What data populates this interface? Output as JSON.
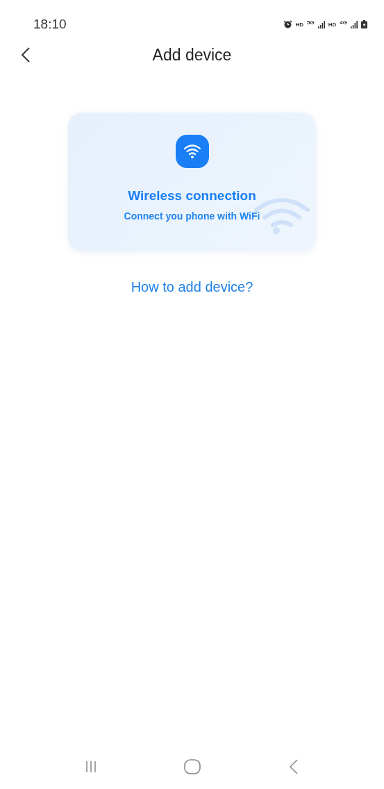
{
  "status_bar": {
    "time": "18:10",
    "network_labels": [
      "HD",
      "5G",
      "HD",
      "4G"
    ]
  },
  "header": {
    "title": "Add device"
  },
  "connection_card": {
    "title": "Wireless connection",
    "subtitle": "Connect you phone with WiFi"
  },
  "help_link": "How to add device?"
}
